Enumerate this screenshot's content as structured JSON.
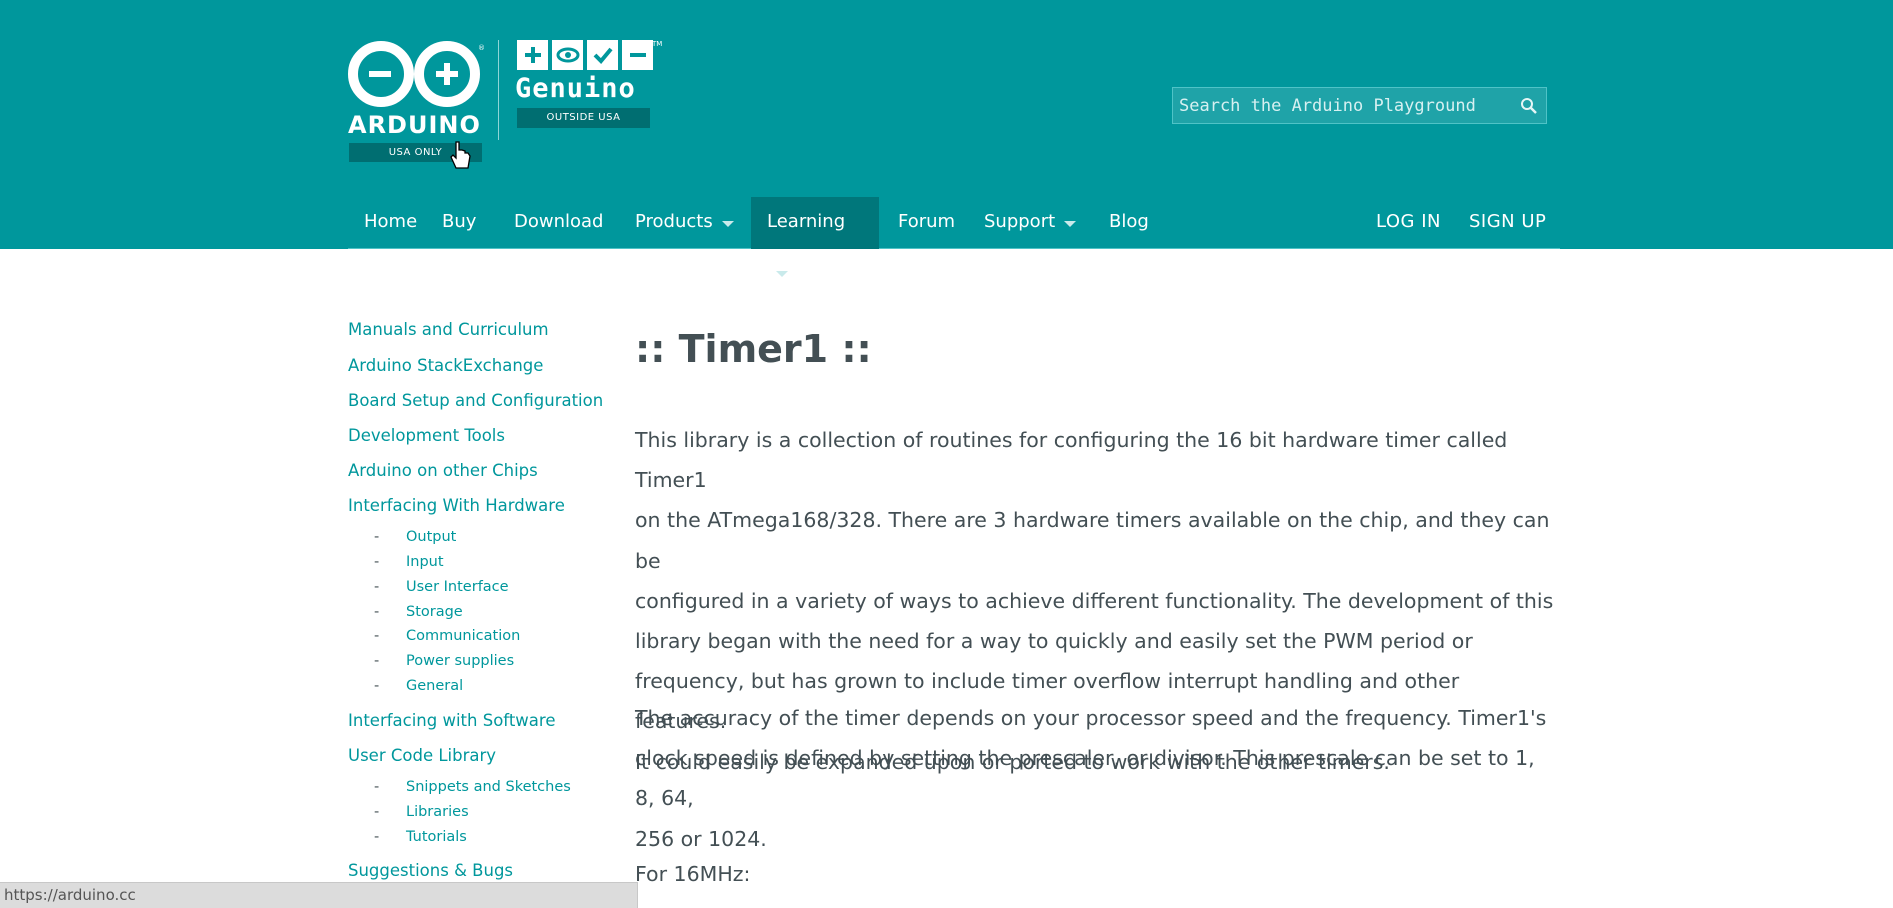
{
  "header": {
    "arduino_word": "ARDUINO",
    "arduino_tag": "USA ONLY",
    "genuino_word": "Genuino",
    "genuino_tag": "OUTSIDE USA",
    "genuino_tm": "TM",
    "search": {
      "placeholder": "Search the Arduino Playground"
    }
  },
  "nav": {
    "items": [
      {
        "label": "Home"
      },
      {
        "label": "Buy"
      },
      {
        "label": "Download"
      },
      {
        "label": "Products"
      },
      {
        "label": "Learning"
      },
      {
        "label": "Forum"
      },
      {
        "label": "Support"
      },
      {
        "label": "Blog"
      }
    ],
    "login": "LOG IN",
    "signup": "SIGN UP"
  },
  "sidebar": {
    "links": [
      "Manuals and Curriculum",
      "Arduino StackExchange",
      "Board Setup and Configuration",
      "Development Tools",
      "Arduino on other Chips",
      "Interfacing With Hardware",
      "Interfacing with Software",
      "User Code Library",
      "Suggestions & Bugs"
    ],
    "hardware_sub": [
      "Output",
      "Input",
      "User Interface",
      "Storage",
      "Communication",
      "Power supplies",
      "General"
    ],
    "library_sub": [
      "Snippets and Sketches",
      "Libraries",
      "Tutorials"
    ],
    "dash": "-"
  },
  "main": {
    "title": ":: Timer1 ::",
    "para1": [
      "This library is a collection of routines for configuring the 16 bit hardware timer called Timer1",
      "on the ATmega168/328. There are 3 hardware timers available on the chip, and they can be",
      "configured in a variety of ways to achieve different functionality. The development of this",
      "library began with the need for a way to quickly and easily set the PWM period or",
      "frequency, but has grown to include timer overflow interrupt handling and other features.",
      "It could easily be expanded upon or ported to work with the other timers."
    ],
    "para2": [
      "The accuracy of the timer depends on your processor speed and the frequency. Timer1's",
      "clock speed is defined by setting the prescaler, or divisor. This prescale can be set to 1, 8, 64,",
      "256 or 1024."
    ],
    "para3": "For 16MHz:"
  },
  "statusbar": {
    "url": "https://arduino.cc"
  }
}
